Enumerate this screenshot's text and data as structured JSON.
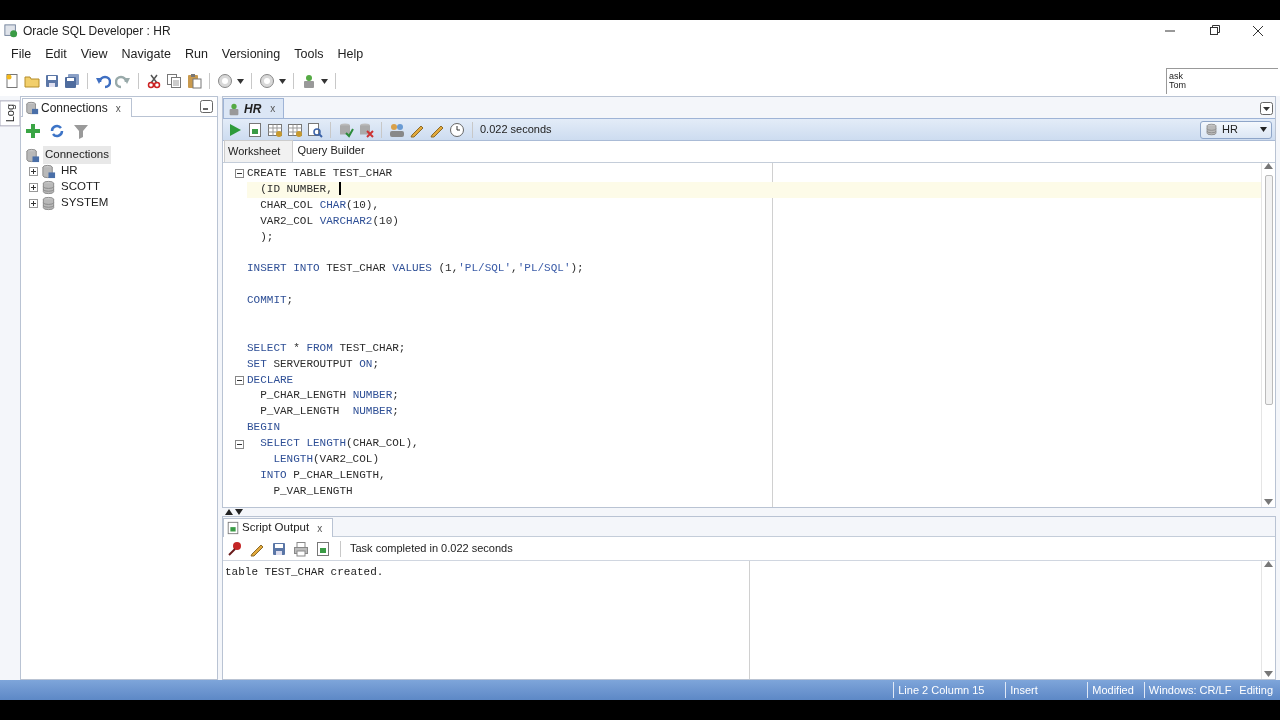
{
  "window": {
    "title": "Oracle SQL Developer : HR"
  },
  "menu": [
    "File",
    "Edit",
    "View",
    "Navigate",
    "Run",
    "Versioning",
    "Tools",
    "Help"
  ],
  "ask_tom": {
    "line_1": "ask",
    "line_2": "Tom"
  },
  "side_tabs": [
    "Log"
  ],
  "connections_panel": {
    "tab": {
      "label": "Connections",
      "close": "x"
    },
    "tree": [
      {
        "label": "Connections",
        "selected": true,
        "children": [
          {
            "label": "HR",
            "selected": false,
            "expanded": false
          },
          {
            "label": "SCOTT",
            "selected": false,
            "expanded": false
          },
          {
            "label": "SYSTEM",
            "selected": false,
            "expanded": false
          }
        ]
      }
    ]
  },
  "editor": {
    "tab": {
      "label": "HR",
      "close": "x"
    },
    "elapsed": "0.022 seconds",
    "connection": "HR",
    "subtabs": [
      {
        "label": "Worksheet",
        "selected": true
      },
      {
        "label": "Query Builder",
        "selected": false
      }
    ],
    "lines": [
      {
        "kind": "code",
        "fold": true,
        "current": false,
        "tokens": [
          {
            "kind": "plain",
            "text": "CREATE TABLE TEST_CHAR"
          }
        ]
      },
      {
        "kind": "code",
        "fold": false,
        "current": true,
        "tokens": [
          {
            "kind": "plain",
            "text": "  (ID NUMBER, "
          }
        ]
      },
      {
        "kind": "code",
        "fold": false,
        "current": false,
        "tokens": [
          {
            "kind": "plain",
            "text": "  CHAR_COL "
          },
          {
            "kind": "keyword",
            "text": "CHAR"
          },
          {
            "kind": "plain",
            "text": "(10),"
          }
        ]
      },
      {
        "kind": "code",
        "fold": false,
        "current": false,
        "tokens": [
          {
            "kind": "plain",
            "text": "  VAR2_COL "
          },
          {
            "kind": "keyword",
            "text": "VARCHAR2"
          },
          {
            "kind": "plain",
            "text": "(10)"
          }
        ]
      },
      {
        "kind": "code",
        "fold": false,
        "current": false,
        "tokens": [
          {
            "kind": "plain",
            "text": "  );"
          }
        ]
      },
      {
        "kind": "blank",
        "current": false
      },
      {
        "kind": "code",
        "fold": false,
        "current": false,
        "tokens": [
          {
            "kind": "keyword",
            "text": "INSERT INTO"
          },
          {
            "kind": "plain",
            "text": " TEST_CHAR "
          },
          {
            "kind": "keyword",
            "text": "VALUES"
          },
          {
            "kind": "plain",
            "text": " (1,"
          },
          {
            "kind": "string",
            "text": "'PL/SQL'"
          },
          {
            "kind": "plain",
            "text": ","
          },
          {
            "kind": "string",
            "text": "'PL/SQL'"
          },
          {
            "kind": "plain",
            "text": ");"
          }
        ]
      },
      {
        "kind": "blank",
        "current": false
      },
      {
        "kind": "code",
        "fold": false,
        "current": false,
        "tokens": [
          {
            "kind": "keyword",
            "text": "COMMIT"
          },
          {
            "kind": "plain",
            "text": ";"
          }
        ]
      },
      {
        "kind": "blank",
        "current": false
      },
      {
        "kind": "blank",
        "current": false
      },
      {
        "kind": "code",
        "fold": false,
        "current": false,
        "tokens": [
          {
            "kind": "keyword",
            "text": "SELECT"
          },
          {
            "kind": "plain",
            "text": " * "
          },
          {
            "kind": "keyword",
            "text": "FROM"
          },
          {
            "kind": "plain",
            "text": " TEST_CHAR;"
          }
        ]
      },
      {
        "kind": "code",
        "fold": false,
        "current": false,
        "tokens": [
          {
            "kind": "keyword",
            "text": "SET"
          },
          {
            "kind": "plain",
            "text": " SERVEROUTPUT "
          },
          {
            "kind": "keyword",
            "text": "ON"
          },
          {
            "kind": "plain",
            "text": ";"
          }
        ]
      },
      {
        "kind": "code",
        "fold": true,
        "current": false,
        "tokens": [
          {
            "kind": "keyword",
            "text": "DECLARE"
          }
        ]
      },
      {
        "kind": "code",
        "fold": false,
        "current": false,
        "tokens": [
          {
            "kind": "plain",
            "text": "  P_CHAR_LENGTH "
          },
          {
            "kind": "keyword",
            "text": "NUMBER"
          },
          {
            "kind": "plain",
            "text": ";"
          }
        ]
      },
      {
        "kind": "code",
        "fold": false,
        "current": false,
        "tokens": [
          {
            "kind": "plain",
            "text": "  P_VAR_LENGTH  "
          },
          {
            "kind": "keyword",
            "text": "NUMBER"
          },
          {
            "kind": "plain",
            "text": ";"
          }
        ]
      },
      {
        "kind": "code",
        "fold": false,
        "current": false,
        "tokens": [
          {
            "kind": "keyword",
            "text": "BEGIN"
          }
        ]
      },
      {
        "kind": "code",
        "fold": true,
        "current": false,
        "tokens": [
          {
            "kind": "keyword",
            "text": "  SELECT LENGTH"
          },
          {
            "kind": "plain",
            "text": "(CHAR_COL),"
          }
        ]
      },
      {
        "kind": "code",
        "fold": false,
        "current": false,
        "tokens": [
          {
            "kind": "keyword",
            "text": "    LENGTH"
          },
          {
            "kind": "plain",
            "text": "(VAR2_COL)"
          }
        ]
      },
      {
        "kind": "code",
        "fold": false,
        "current": false,
        "tokens": [
          {
            "kind": "keyword",
            "text": "  INTO"
          },
          {
            "kind": "plain",
            "text": " P_CHAR_LENGTH,"
          }
        ]
      },
      {
        "kind": "code",
        "fold": false,
        "current": false,
        "tokens": [
          {
            "kind": "plain",
            "text": "    P_VAR_LENGTH"
          }
        ]
      }
    ]
  },
  "script_output": {
    "tab": {
      "label": "Script Output",
      "close": "x"
    },
    "message": "Task completed in 0.022 seconds",
    "lines": [
      "table TEST_CHAR created."
    ]
  },
  "status_bar": [
    "Line 2 Column 15",
    "Insert",
    "Modified",
    "Windows: CR/LF",
    "Editing"
  ]
}
